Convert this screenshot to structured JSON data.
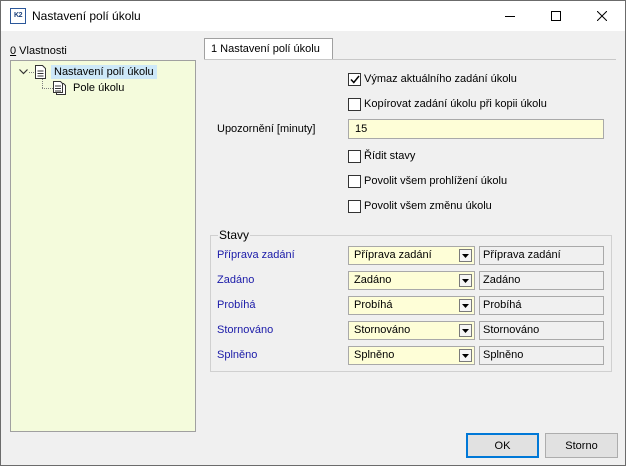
{
  "window": {
    "title": "Nastavení polí úkolu",
    "icon_text": "K2",
    "minimize_icon": "minimize-icon",
    "maximize_icon": "maximize-icon",
    "close_icon": "close-icon"
  },
  "left_panel": {
    "header_prefix": "0",
    "header_label": " Vlastnosti",
    "tree": [
      {
        "label": "Nastavení polí úkolu",
        "selected": true,
        "icon": "document-icon"
      },
      {
        "label": "Pole úkolu",
        "selected": false,
        "icon": "document-list-icon"
      }
    ]
  },
  "tab": {
    "label": "1 Nastavení polí úkolu"
  },
  "options": {
    "cb1": {
      "label": "Výmaz aktuálního zadání úkolu",
      "checked": true
    },
    "cb2": {
      "label": "Kopírovat zadání úkolu při kopii úkolu",
      "checked": false
    },
    "reminder_label": "Upozornění [minuty]",
    "reminder_value": "15",
    "cb3": {
      "label": "Řídit stavy",
      "checked": false
    },
    "cb4": {
      "label": "Povolit všem prohlížení úkolu",
      "checked": false
    },
    "cb5": {
      "label": "Povolit všem změnu úkolu",
      "checked": false
    }
  },
  "states": {
    "title": "Stavy",
    "rows": [
      {
        "label": "Příprava zadání",
        "select": "Příprava zadání",
        "value": "Příprava zadání"
      },
      {
        "label": "Zadáno",
        "select": "Zadáno",
        "value": "Zadáno"
      },
      {
        "label": "Probíhá",
        "select": "Probíhá",
        "value": "Probíhá"
      },
      {
        "label": "Stornováno",
        "select": "Stornováno",
        "value": "Stornováno"
      },
      {
        "label": "Splněno",
        "select": "Splněno",
        "value": "Splněno"
      }
    ]
  },
  "buttons": {
    "ok": "OK",
    "cancel": "Storno"
  },
  "colors": {
    "tree_bg": "#f4fbdc",
    "input_bg": "#fefed7",
    "state_label": "#1a1aa8",
    "selection": "#cde8f8"
  }
}
